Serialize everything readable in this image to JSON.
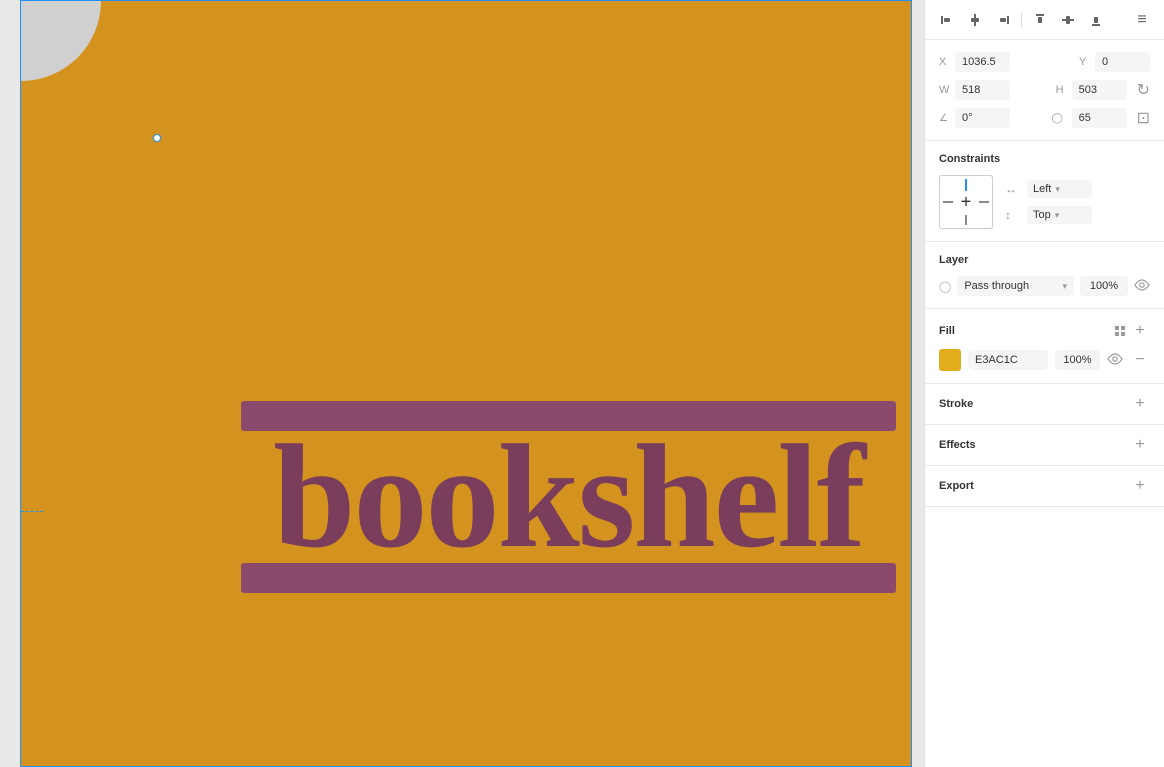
{
  "canvas": {
    "background": "#d0d0d0"
  },
  "artboard": {
    "color": "#D4921E"
  },
  "bookshelf": {
    "text": "bookshelf",
    "bar_color": "#8B4A6B",
    "text_color": "#7A3D5C"
  },
  "align_toolbar": {
    "buttons": [
      {
        "name": "align-left",
        "symbol": "⊢"
      },
      {
        "name": "align-center-h",
        "symbol": "⊕"
      },
      {
        "name": "align-right",
        "symbol": "⊣"
      },
      {
        "name": "align-top",
        "symbol": "⊤"
      },
      {
        "name": "align-center-v",
        "symbol": "⊥"
      },
      {
        "name": "align-bottom",
        "symbol": "⊥"
      }
    ],
    "more": "≡"
  },
  "properties": {
    "x_label": "X",
    "x_value": "1036.5",
    "y_label": "Y",
    "y_value": "0",
    "w_label": "W",
    "w_value": "518",
    "h_label": "H",
    "h_value": "503",
    "angle_label": "∠",
    "angle_value": "0°",
    "corner_label": "◯",
    "corner_value": "65"
  },
  "constraints": {
    "title": "Constraints",
    "horizontal_label": "↔",
    "horizontal_value": "Left",
    "vertical_label": "↕",
    "vertical_value": "Top"
  },
  "layer": {
    "title": "Layer",
    "blend_mode": "Pass through",
    "opacity": "100%",
    "visibility_icon": "👁"
  },
  "fill": {
    "title": "Fill",
    "color_hex": "E3AC1C",
    "opacity": "100%"
  },
  "stroke": {
    "title": "Stroke"
  },
  "effects": {
    "title": "Effects"
  },
  "export": {
    "title": "Export"
  }
}
